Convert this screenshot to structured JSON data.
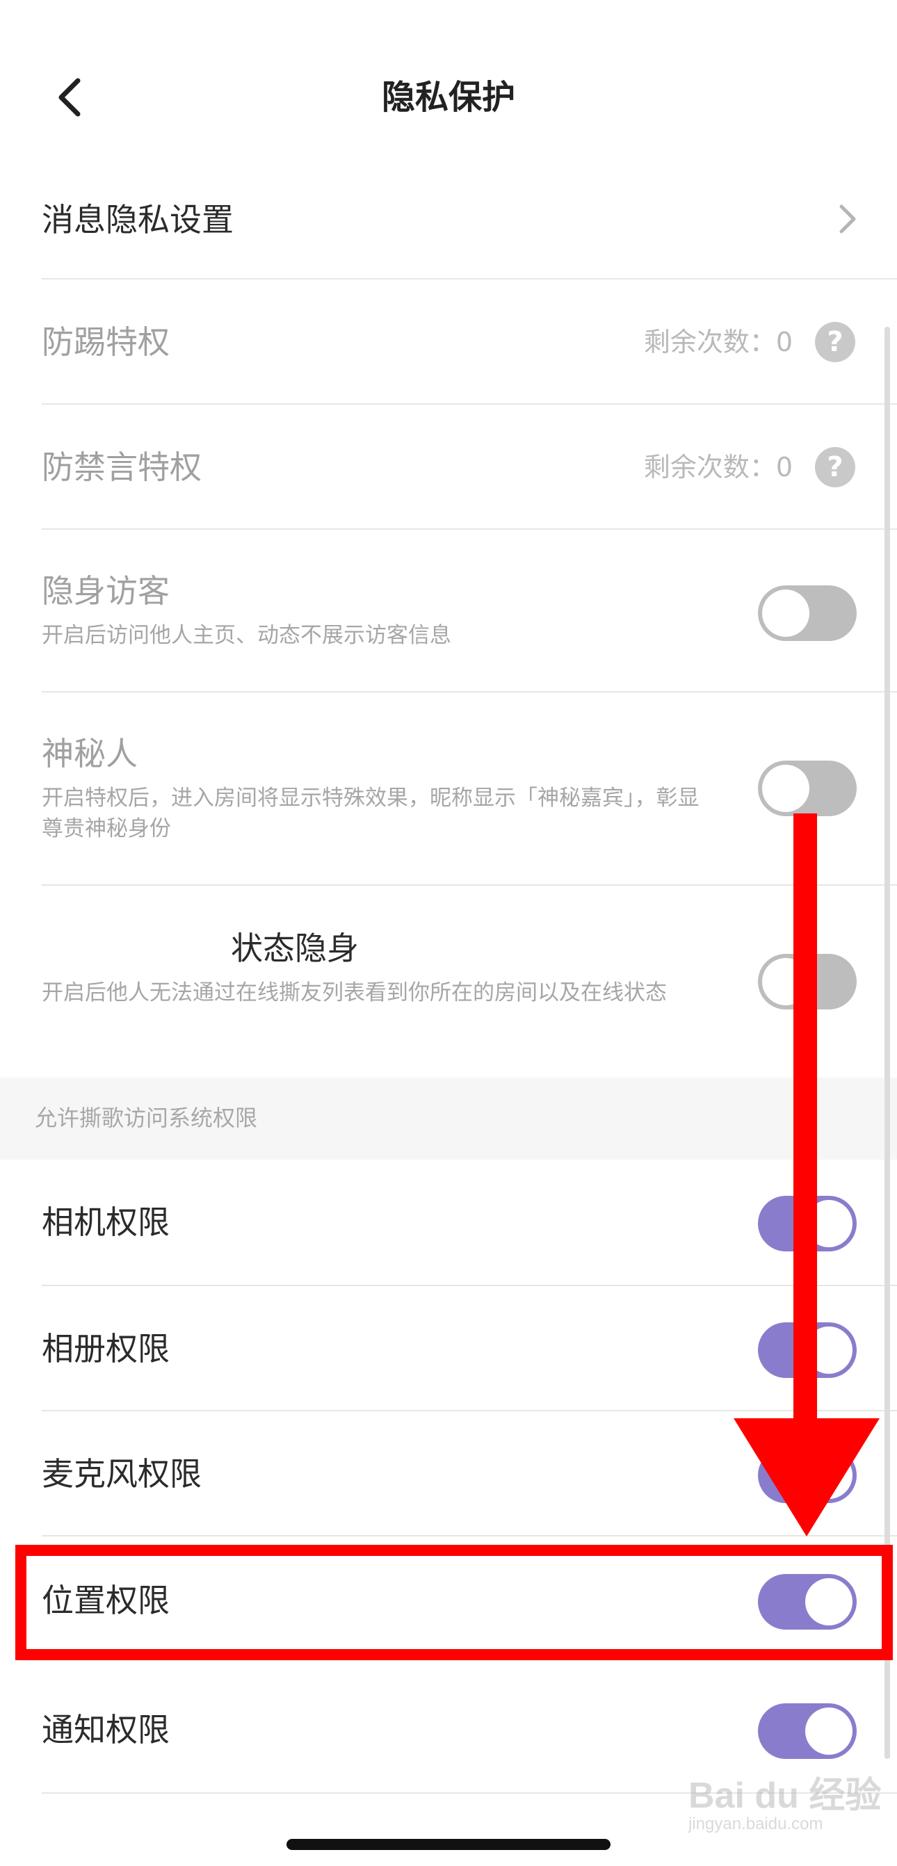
{
  "header": {
    "title": "隐私保护"
  },
  "rows": {
    "message_privacy": {
      "label": "消息隐私设置"
    },
    "anti_kick": {
      "label": "防踢特权",
      "count_label": "剩余次数：0"
    },
    "anti_mute": {
      "label": "防禁言特权",
      "count_label": "剩余次数：0"
    },
    "invisible_visitor": {
      "label": "隐身访客",
      "desc": "开启后访问他人主页、动态不展示访客信息",
      "enabled": false
    },
    "mystery_person": {
      "label": "神秘人",
      "desc": "开启特权后，进入房间将显示特殊效果，昵称显示「神秘嘉宾」，彰显尊贵神秘身份",
      "enabled": false
    },
    "status_invisible": {
      "label": "状态隐身",
      "desc": "开启后他人无法通过在线撕友列表看到你所在的房间以及在线状态",
      "enabled": false
    }
  },
  "section": {
    "label": "允许撕歌访问系统权限"
  },
  "permissions": {
    "camera": {
      "label": "相机权限",
      "enabled": true
    },
    "album": {
      "label": "相册权限",
      "enabled": true
    },
    "microphone": {
      "label": "麦克风权限",
      "enabled": true
    },
    "location": {
      "label": "位置权限",
      "enabled": true
    },
    "notification": {
      "label": "通知权限",
      "enabled": true
    }
  },
  "icons": {
    "back": "chevron-left-icon",
    "chevron": "chevron-right-icon",
    "help": "question-circle-icon"
  },
  "help_glyph": "?",
  "colors": {
    "toggle_on": "#8a7ccd",
    "toggle_off": "#bdbdbd",
    "annotation": "#ff0000"
  },
  "watermark": {
    "main": "Bai du 经验",
    "sub": "jingyan.baidu.com"
  }
}
